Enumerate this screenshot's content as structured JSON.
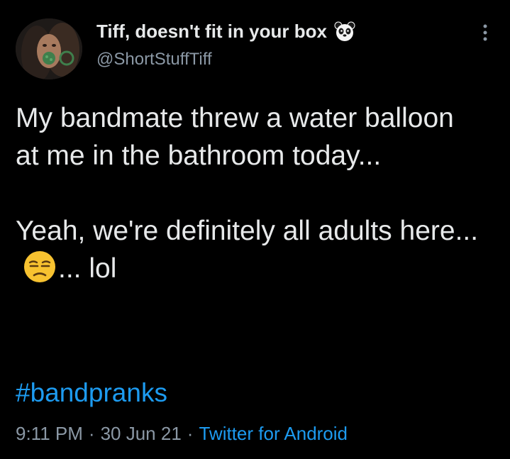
{
  "author": {
    "display_name": "Tiff, doesn't fit in your box",
    "handle": "@ShortStuffTiff",
    "name_emoji_icon": "panda-face-icon"
  },
  "more_menu_icon": "vertical-ellipsis-icon",
  "tweet": {
    "text_part1": "My bandmate threw a water balloon at me in the bathroom today...",
    "text_part2_before_emoji": "Yeah, we're definitely all adults here...",
    "emoji_icon": "unamused-face-icon",
    "text_part2_after_emoji": "... lol",
    "hashtag": "#bandpranks"
  },
  "meta": {
    "time": "9:11 PM",
    "separator": "·",
    "date": "30 Jun 21",
    "source": "Twitter for Android"
  },
  "colors": {
    "background": "#000000",
    "text": "#e7e9ea",
    "secondary_text": "#8b98a5",
    "link": "#1d9bf0"
  }
}
